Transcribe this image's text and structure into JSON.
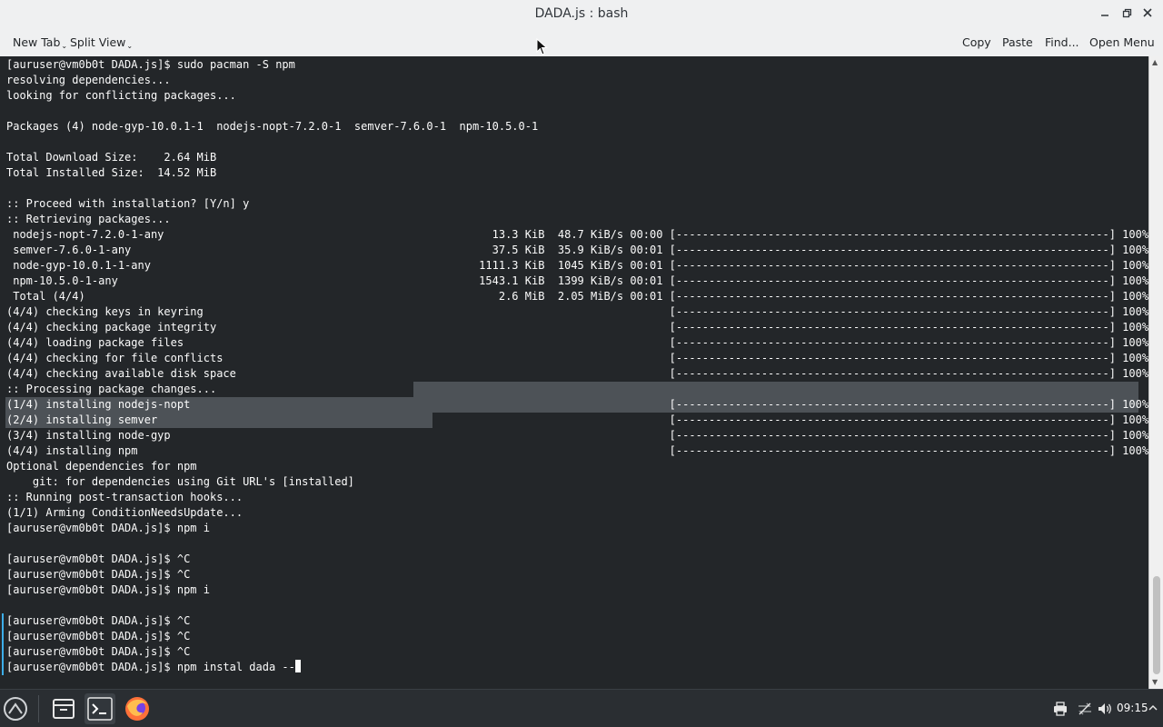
{
  "window": {
    "title": "DADA.js : bash"
  },
  "toolbar": {
    "new_tab": "New Tab",
    "split_view": "Split View",
    "copy": "Copy",
    "paste": "Paste",
    "find": "Find...",
    "open_menu": "Open Menu"
  },
  "terminal": {
    "lines": [
      "[auruser@vm0b0t DADA.js]$ sudo pacman -S npm",
      "resolving dependencies...",
      "looking for conflicting packages...",
      "",
      "Packages (4) node-gyp-10.0.1-1  nodejs-nopt-7.2.0-1  semver-7.6.0-1  npm-10.5.0-1",
      "",
      "Total Download Size:    2.64 MiB",
      "Total Installed Size:  14.52 MiB",
      "",
      ":: Proceed with installation? [Y/n] y",
      ":: Retrieving packages...",
      " nodejs-nopt-7.2.0-1-any                                                  13.3 KiB  48.7 KiB/s 00:00 [------------------------------------------------------------------] 100%",
      " semver-7.6.0-1-any                                                       37.5 KiB  35.9 KiB/s 00:01 [------------------------------------------------------------------] 100%",
      " node-gyp-10.0.1-1-any                                                  1111.3 KiB  1045 KiB/s 00:01 [------------------------------------------------------------------] 100%",
      " npm-10.5.0-1-any                                                       1543.1 KiB  1399 KiB/s 00:01 [------------------------------------------------------------------] 100%",
      " Total (4/4)                                                               2.6 MiB  2.05 MiB/s 00:01 [------------------------------------------------------------------] 100%",
      "(4/4) checking keys in keyring                                                                       [------------------------------------------------------------------] 100%",
      "(4/4) checking package integrity                                                                     [------------------------------------------------------------------] 100%",
      "(4/4) loading package files                                                                          [------------------------------------------------------------------] 100%",
      "(4/4) checking for file conflicts                                                                    [------------------------------------------------------------------] 100%",
      "(4/4) checking available disk space                                                                  [------------------------------------------------------------------] 100%",
      ":: Processing package changes...",
      "(1/4) installing nodejs-nopt                                                                         [------------------------------------------------------------------] 100%",
      "(2/4) installing semver                                                                              [------------------------------------------------------------------] 100%",
      "(3/4) installing node-gyp                                                                            [------------------------------------------------------------------] 100%",
      "(4/4) installing npm                                                                                 [------------------------------------------------------------------] 100%",
      "Optional dependencies for npm",
      "    git: for dependencies using Git URL's [installed]",
      ":: Running post-transaction hooks...",
      "(1/1) Arming ConditionNeedsUpdate...",
      "[auruser@vm0b0t DADA.js]$ npm i",
      "",
      "[auruser@vm0b0t DADA.js]$ ^C",
      "[auruser@vm0b0t DADA.js]$ ^C",
      "[auruser@vm0b0t DADA.js]$ npm i",
      "",
      "[auruser@vm0b0t DADA.js]$ ^C",
      "[auruser@vm0b0t DADA.js]$ ^C",
      "[auruser@vm0b0t DADA.js]$ ^C",
      "[auruser@vm0b0t DADA.js]$ npm instal dada --"
    ]
  },
  "taskbar": {
    "items": [
      "app-launcher-icon",
      "file-manager-icon",
      "terminal-icon",
      "firefox-icon"
    ],
    "tray": [
      "printer-icon",
      "network-icon",
      "volume-icon",
      "chevron-up-icon"
    ],
    "clock": "09:15"
  },
  "colors": {
    "terminal_bg": "#232629",
    "terminal_fg": "#fcfcfc",
    "selection": "#4d5257",
    "chrome": "#eff0f1",
    "taskbar": "#2a2e32"
  }
}
